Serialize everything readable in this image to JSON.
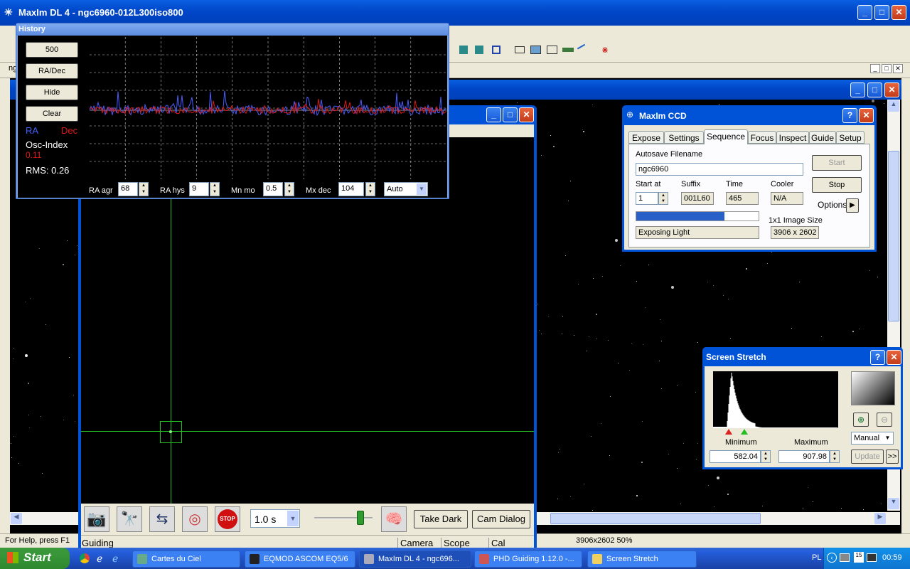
{
  "maxim_title": "MaxIm DL 4 - ngc6960-012L300iso800",
  "history": {
    "title": "History",
    "buttons": [
      "500",
      "RA/Dec",
      "Hide",
      "Clear"
    ],
    "legend_ra": "RA",
    "legend_dec": "Dec",
    "osc_label": "Osc-Index",
    "osc_value": "0.11",
    "rms": "RMS: 0.26",
    "ra_agr_label": "RA agr",
    "ra_agr": "68",
    "ra_hys_label": "RA hys",
    "ra_hys": "9",
    "mn_mo_label": "Mn mo",
    "mn_mo": "0.5",
    "mx_dec_label": "Mx dec",
    "mx_dec": "104",
    "mode": "Auto"
  },
  "maxim_left_frags": [
    "ngc"
  ],
  "ccd": {
    "title": "MaxIm CCD",
    "tabs": [
      "Expose",
      "Settings",
      "Sequence",
      "Focus",
      "Inspect",
      "Guide",
      "Setup"
    ],
    "active_tab": "Sequence",
    "autosave_label": "Autosave Filename",
    "autosave": "ngc6960",
    "start_at_label": "Start at",
    "start_at": "1",
    "suffix_label": "Suffix",
    "suffix": "001L60",
    "time_label": "Time",
    "time": "465",
    "cooler_label": "Cooler",
    "cooler": "N/A",
    "start_btn": "Start",
    "stop_btn": "Stop",
    "options": "Options",
    "status": "Exposing Light",
    "progress": 0.72,
    "size_label": "1x1 Image Size",
    "size": "3906 x 2602"
  },
  "stretch": {
    "title": "Screen Stretch",
    "min_label": "Minimum",
    "max_label": "Maximum",
    "min": "582.04",
    "max": "907.98",
    "mode": "Manual",
    "update": "Update",
    "more": ">>"
  },
  "phd": {
    "exposure": "1.0 s",
    "take_dark": "Take Dark",
    "cam_dialog": "Cam Dialog",
    "status_guiding": "Guiding",
    "status_camera": "Camera",
    "status_scope": "Scope",
    "status_cal": "Cal"
  },
  "statusbar": {
    "help": "For Help, press F1",
    "image_info": "3906x2602  50%"
  },
  "taskbar": {
    "start": "Start",
    "items": [
      "Cartes du Ciel",
      "EQMOD ASCOM EQ5/6",
      "MaxIm DL 4 - ngc696...",
      "PHD Guiding 1.12.0 -...",
      "Screen Stretch"
    ],
    "lang": "PL",
    "time": "00:59",
    "day": "15"
  }
}
